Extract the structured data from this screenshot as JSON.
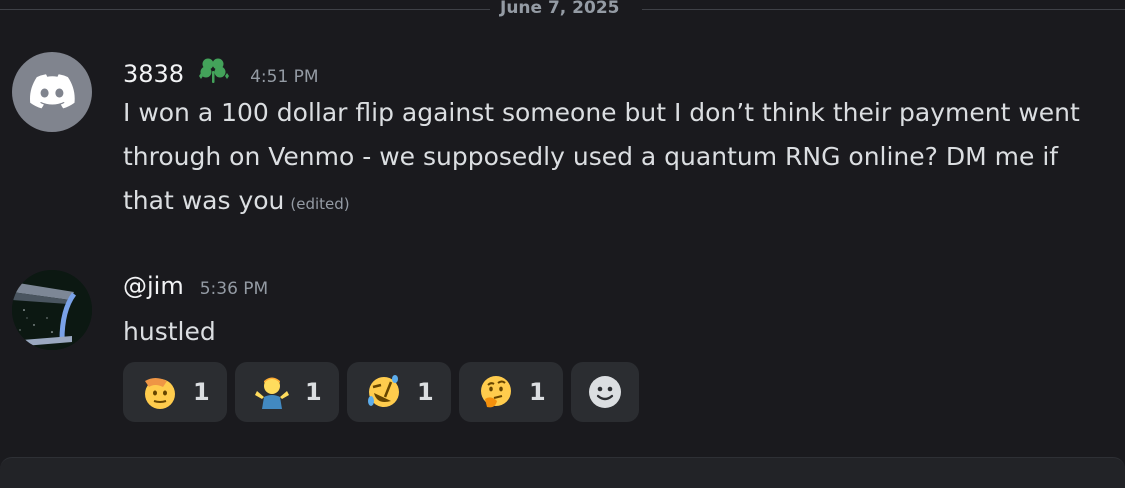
{
  "date_divider": "June 7, 2025",
  "messages": [
    {
      "username": "3838",
      "badge_icon": "clover-badge-icon",
      "timestamp": "4:51 PM",
      "text": "I won a 100 dollar flip against someone but I don’t think their payment went through on Venmo - we supposedly used a quantum RNG online? DM me if that was you",
      "edited_label": "(edited)",
      "avatar_icon": "discord-logo-icon"
    },
    {
      "username": "@jim",
      "timestamp": "5:36 PM",
      "text": "hustled",
      "avatar_icon": "user-photo-avatar"
    }
  ],
  "reactions": [
    {
      "emoji": "saluting-face-icon",
      "count": "1"
    },
    {
      "emoji": "person-shrugging-icon",
      "count": "1"
    },
    {
      "emoji": "rolling-on-floor-laughing-icon",
      "count": "1"
    },
    {
      "emoji": "thinking-face-icon",
      "count": "1"
    }
  ],
  "add_reaction_icon": "add-reaction-smiley-icon",
  "colors": {
    "background": "#1a1a1e",
    "reaction_bg": "#2b2d31",
    "muted": "#949ba4",
    "badge_green": "#43a25a"
  }
}
